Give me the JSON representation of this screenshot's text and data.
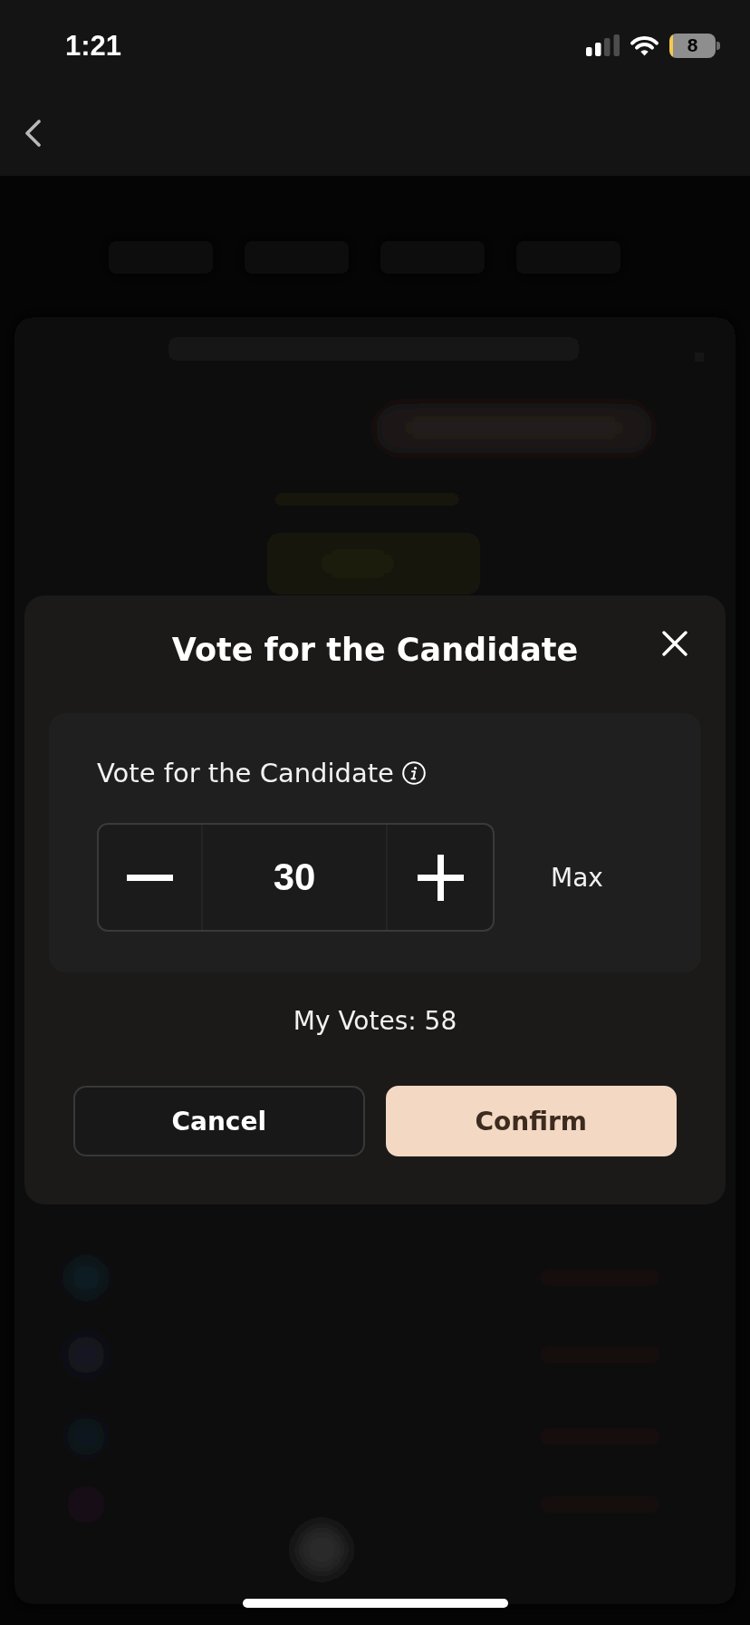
{
  "status_bar": {
    "time": "1:21",
    "battery": "8"
  },
  "dialog": {
    "title": "Vote for the Candidate",
    "field_label": "Vote for the Candidate",
    "quantity": "30",
    "max_label": "Max",
    "balance": "My Votes: 58",
    "buttons": [
      {
        "label": "Cancel",
        "kind": "secondary"
      },
      {
        "label": "Confirm",
        "kind": "primary"
      }
    ]
  }
}
